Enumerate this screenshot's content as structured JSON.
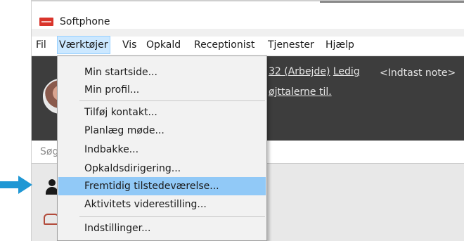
{
  "window": {
    "title": "Softphone",
    "icon": "app-logo-icon"
  },
  "menubar": {
    "items": [
      {
        "label": "Fil",
        "active": false
      },
      {
        "label": "Værktøjer",
        "active": true
      },
      {
        "label": "Vis",
        "active": false
      },
      {
        "label": "Opkald",
        "active": false
      },
      {
        "label": "Receptionist",
        "active": false
      },
      {
        "label": "Tjenester",
        "active": false
      },
      {
        "label": "Hjælp",
        "active": false
      }
    ]
  },
  "header": {
    "status_prefix": "32 (Arbejde)",
    "status_word": "Ledig",
    "note": "<Indtast note>",
    "second_line": "øjttalerne til."
  },
  "search": {
    "placeholder": "Søg"
  },
  "dropdown": {
    "items": [
      {
        "label": "Min startside..."
      },
      {
        "label": "Min profil..."
      },
      {
        "label": "Tilføj kontakt..."
      },
      {
        "label": "Planlæg møde..."
      },
      {
        "label": "Indbakke..."
      },
      {
        "label": "Opkaldsdirigering..."
      },
      {
        "label": "Fremtidig tilstedeværelse...",
        "highlighted": true
      },
      {
        "label": "Aktivitets viderestilling..."
      },
      {
        "label": "Indstillinger..."
      }
    ]
  },
  "colors": {
    "accent_arrow": "#1f97d4",
    "menu_highlight": "#91c9f7",
    "header_bg": "#3d3d3d",
    "app_icon": "#d9342b"
  }
}
